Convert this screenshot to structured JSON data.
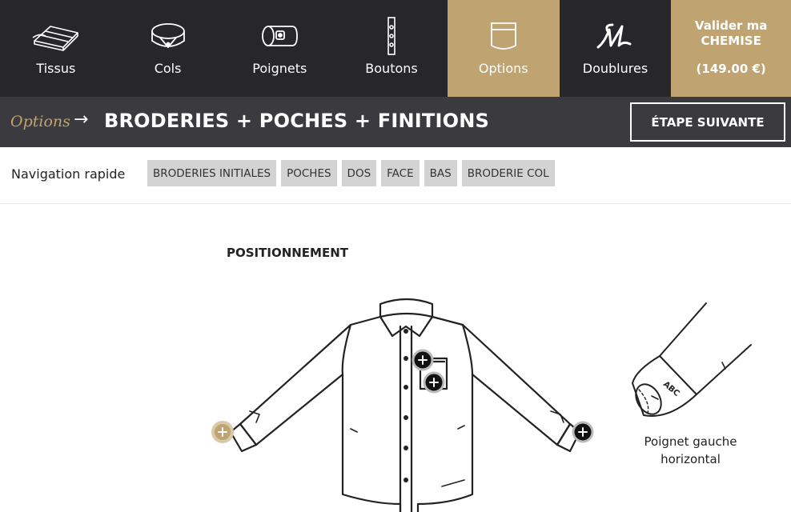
{
  "nav": {
    "items": [
      {
        "label": "Tissus",
        "icon": "fabric-icon"
      },
      {
        "label": "Cols",
        "icon": "collar-icon"
      },
      {
        "label": "Poignets",
        "icon": "cuff-icon"
      },
      {
        "label": "Boutons",
        "icon": "buttons-icon"
      },
      {
        "label": "Options",
        "icon": "pocket-icon",
        "active": true
      },
      {
        "label": "Doublures",
        "icon": "monogram-m-icon"
      }
    ],
    "validate": {
      "line1": "Valider ma",
      "line2": "CHEMISE",
      "price": "(149.00 €)"
    }
  },
  "titlebar": {
    "crumb": "Options",
    "arrow": "→",
    "title": "BRODERIES + POCHES + FINITIONS",
    "next_label": "ÉTAPE SUIVANTE"
  },
  "quicknav": {
    "label": "Navigation rapide",
    "chips": [
      "BRODERIES INITIALES",
      "POCHES",
      "DOS",
      "FACE",
      "BAS",
      "BRODERIE COL"
    ]
  },
  "main": {
    "section_title": "POSITIONNEMENT",
    "cuff_text": "ABC",
    "caption_line1": "Poignet gauche",
    "caption_line2": "horizontal"
  },
  "colors": {
    "nav_bg": "#27262b",
    "accent_gold": "#bfa370",
    "titlebar_bg": "#3b3b3f",
    "chip_bg": "#d3d3d3"
  }
}
